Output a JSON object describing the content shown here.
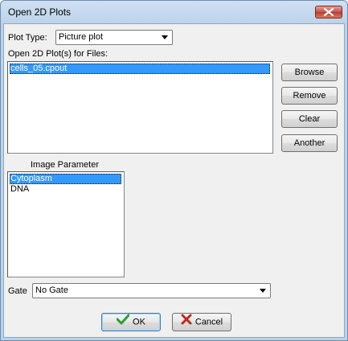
{
  "window": {
    "title": "Open 2D Plots"
  },
  "plot_type": {
    "label": "Plot Type:",
    "selected": "Picture plot"
  },
  "files": {
    "label": "Open 2D Plot(s) for Files:",
    "items": [
      "cells_05.cpout"
    ]
  },
  "side_buttons": {
    "browse": "Browse",
    "remove": "Remove",
    "clear": "Clear",
    "another": "Another"
  },
  "image_parameter": {
    "label": "Image Parameter",
    "items": [
      "Cytoplasm",
      "DNA"
    ]
  },
  "gate": {
    "label": "Gate",
    "selected": "No Gate"
  },
  "footer": {
    "ok": "OK",
    "cancel": "Cancel"
  },
  "colors": {
    "selection": "#3399ff",
    "close": "#c75050",
    "ok_check": "#2e9d2e",
    "cancel_x": "#c0281f"
  }
}
